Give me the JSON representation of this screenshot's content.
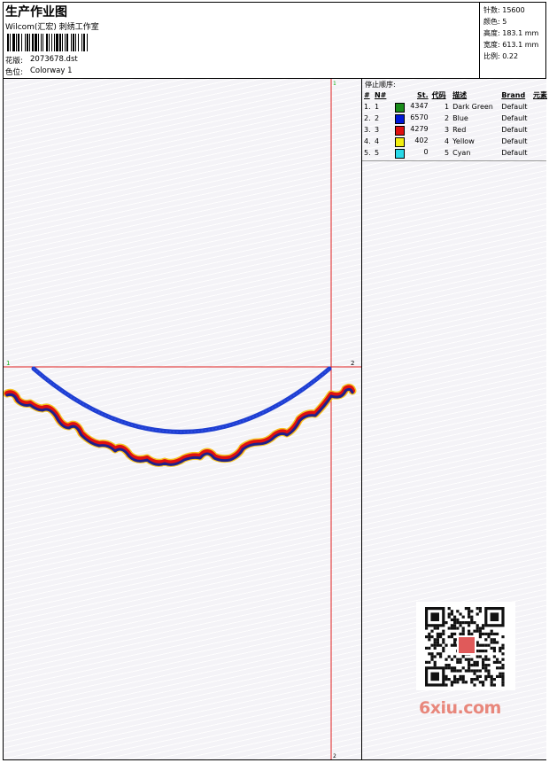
{
  "header": {
    "title": "生产作业图",
    "subtitle": "Wilcom(汇宏) 刺绣工作室",
    "design_label": "花版:",
    "design_value": "2073678.dst",
    "colorway_label": "色位:",
    "colorway_value": "Colorway 1"
  },
  "info": {
    "stitches_label": "针数:",
    "stitches_value": "15600",
    "colors_label": "颜色:",
    "colors_value": "5",
    "height_label": "高度:",
    "height_value": "183.1 mm",
    "width_label": "宽度:",
    "width_value": "613.1 mm",
    "scale_label": "比例:",
    "scale_value": "0.22"
  },
  "stop_sequence": {
    "title": "停止顺序:",
    "columns": [
      "#",
      "N#",
      "St.",
      "代码",
      "描述",
      "Brand",
      "元素"
    ],
    "rows": [
      {
        "idx": "1.",
        "n": "1",
        "color": "#1a8c1a",
        "st": "4347",
        "code": "1",
        "desc": "Dark Green",
        "brand": "Default"
      },
      {
        "idx": "2.",
        "n": "2",
        "color": "#0018d8",
        "st": "6570",
        "code": "2",
        "desc": "Blue",
        "brand": "Default"
      },
      {
        "idx": "3.",
        "n": "3",
        "color": "#e01010",
        "st": "4279",
        "code": "3",
        "desc": "Red",
        "brand": "Default"
      },
      {
        "idx": "4.",
        "n": "4",
        "color": "#f2ee10",
        "st": "402",
        "code": "4",
        "desc": "Yellow",
        "brand": "Default"
      },
      {
        "idx": "5.",
        "n": "5",
        "color": "#28d8e8",
        "st": "0",
        "code": "5",
        "desc": "Cyan",
        "brand": "Default"
      }
    ]
  },
  "canvas": {
    "marker_1": "1",
    "marker_2": "2",
    "marker_top": "1",
    "marker_bottom": "2"
  },
  "watermark": {
    "text": "6xiu.com",
    "seal_text": "设计图库"
  },
  "colors": {
    "guide_line": "#e02020",
    "arc_blue": "#1e3ed0",
    "scallop_red": "#e01010",
    "scallop_navy": "#20208a",
    "scallop_yellow": "#f4c020"
  }
}
